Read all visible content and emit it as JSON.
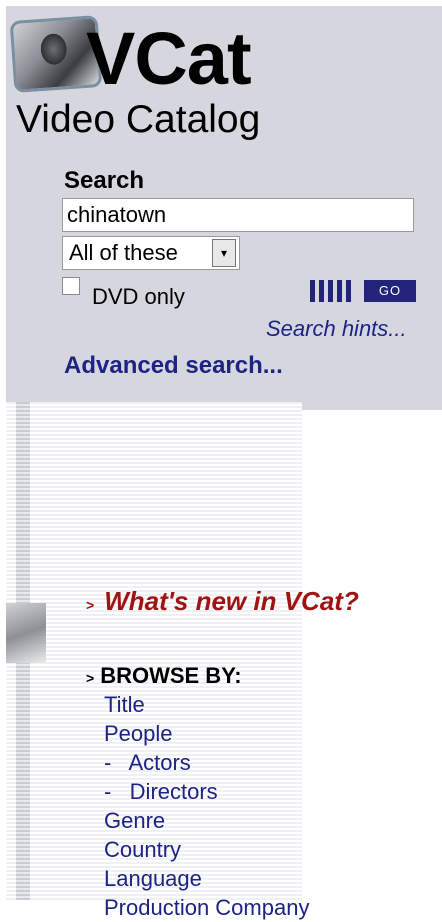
{
  "logo": {
    "title": "VCat",
    "subtitle": "Video Catalog",
    "icon": "tv-cat-icon"
  },
  "search": {
    "label": "Search",
    "query": "chinatown",
    "match_mode": "All of these",
    "dvd_only_label": "DVD only",
    "dvd_only_checked": false,
    "go_label": "GO",
    "hints_label": "Search hints...",
    "advanced_label": "Advanced search..."
  },
  "whats_new": {
    "bullet": ">",
    "label": "What's new in VCat?"
  },
  "browse": {
    "bullet": ">",
    "header": "BROWSE BY:",
    "items": [
      {
        "label": "Title"
      },
      {
        "label": "People"
      },
      {
        "label": "-   Actors"
      },
      {
        "label": "-   Directors"
      },
      {
        "label": "Genre"
      },
      {
        "label": "Country"
      },
      {
        "label": "Language"
      },
      {
        "label": "Production Company"
      }
    ]
  },
  "colors": {
    "panel_bg": "#d6d7de",
    "link_blue": "#1d2384",
    "accent_red": "#a11212",
    "go_bg": "#22237a"
  }
}
